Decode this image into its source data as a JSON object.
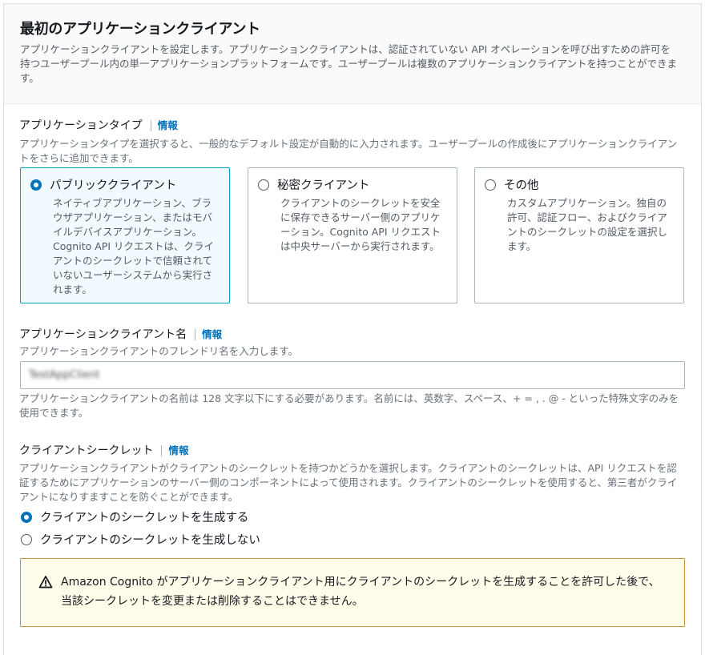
{
  "panel": {
    "title": "最初のアプリケーションクライアント",
    "description": "アプリケーションクライアントを設定します。アプリケーションクライアントは、認証されていない API オペレーションを呼び出すための許可を持つユーザープール内の単一アプリケーションプラットフォームです。ユーザープールは複数のアプリケーションクライアントを持つことができます。"
  },
  "app_type": {
    "label": "アプリケーションタイプ",
    "info": "情報",
    "description": "アプリケーションタイプを選択すると、一般的なデフォルト設定が自動的に入力されます。ユーザープールの作成後にアプリケーションクライアントをさらに追加できます。",
    "options": [
      {
        "title": "パブリッククライアント",
        "description": "ネイティブアプリケーション、ブラウザアプリケーション、またはモバイルデバイスアプリケーション。Cognito API リクエストは、クライアントのシークレットで信頼されていないユーザーシステムから実行されます。",
        "selected": true
      },
      {
        "title": "秘密クライアント",
        "description": "クライアントのシークレットを安全に保存できるサーバー側のアプリケーション。Cognito API リクエストは中央サーバーから実行されます。",
        "selected": false
      },
      {
        "title": "その他",
        "description": "カスタムアプリケーション。独自の許可、認証フロー、およびクライアントのシークレットの設定を選択します。",
        "selected": false
      }
    ]
  },
  "client_name": {
    "label": "アプリケーションクライアント名",
    "info": "情報",
    "description": "アプリケーションクライアントのフレンドリ名を入力します。",
    "value": "TestAppClient",
    "constraint": "アプリケーションクライアントの名前は 128 文字以下にする必要があります。名前には、英数字、スペース、+ = , . @ - といった特殊文字のみを使用できます。"
  },
  "client_secret": {
    "label": "クライアントシークレット",
    "info": "情報",
    "description": "アプリケーションクライアントがクライアントのシークレットを持つかどうかを選択します。クライアントのシークレットは、API リクエストを認証するためにアプリケーションのサーバー側のコンポーネントによって使用されます。クライアントのシークレットを使用すると、第三者がクライアントになりすますことを防ぐことができます。",
    "options": [
      {
        "label": "クライアントのシークレットを生成する",
        "selected": true
      },
      {
        "label": "クライアントのシークレットを生成しない",
        "selected": false
      }
    ]
  },
  "warning": {
    "icon": "warning-triangle-icon",
    "text": "Amazon Cognito がアプリケーションクライアント用にクライアントのシークレットを生成することを許可した後で、当該シークレットを変更または削除することはできません。"
  },
  "colors": {
    "accent": "#0073bb",
    "selected_border": "#00a1c9",
    "selected_bg": "#f1faff",
    "warning_border": "#d09441",
    "warning_bg": "#fffce9"
  }
}
